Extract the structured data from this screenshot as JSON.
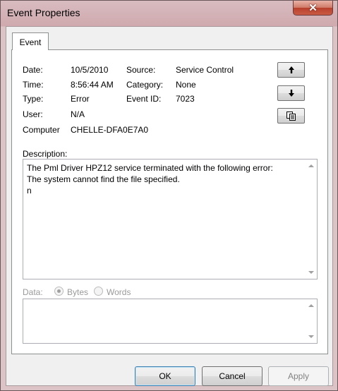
{
  "window": {
    "title": "Event Properties",
    "close_glyph": "✕"
  },
  "tab": {
    "label": "Event"
  },
  "fields": {
    "date_label": "Date:",
    "date_value": "10/5/2010",
    "time_label": "Time:",
    "time_value": "8:56:44 AM",
    "type_label": "Type:",
    "type_value": "Error",
    "user_label": "User:",
    "user_value": "N/A",
    "computer_label": "Computer",
    "computer_value": "CHELLE-DFA0E7A0",
    "source_label": "Source:",
    "source_value": "Service Control",
    "category_label": "Category:",
    "category_value": "None",
    "event_id_label": "Event ID:",
    "event_id_value": "7023"
  },
  "navigation": {
    "up_icon": "arrow-up-icon",
    "down_icon": "arrow-down-icon",
    "copy_icon": "copy-icon"
  },
  "description": {
    "label": "Description:",
    "text": "The Pml Driver HPZ12 service terminated with the following error: \nThe system cannot find the file specified.\nn"
  },
  "data_section": {
    "label": "Data:",
    "options": [
      "Bytes",
      "Words"
    ],
    "selected": "Bytes"
  },
  "buttons": {
    "ok": "OK",
    "cancel": "Cancel",
    "apply": "Apply"
  },
  "colors": {
    "titlebar": "#cfa9ae",
    "close": "#c95a43",
    "client": "#f0f0f0"
  }
}
